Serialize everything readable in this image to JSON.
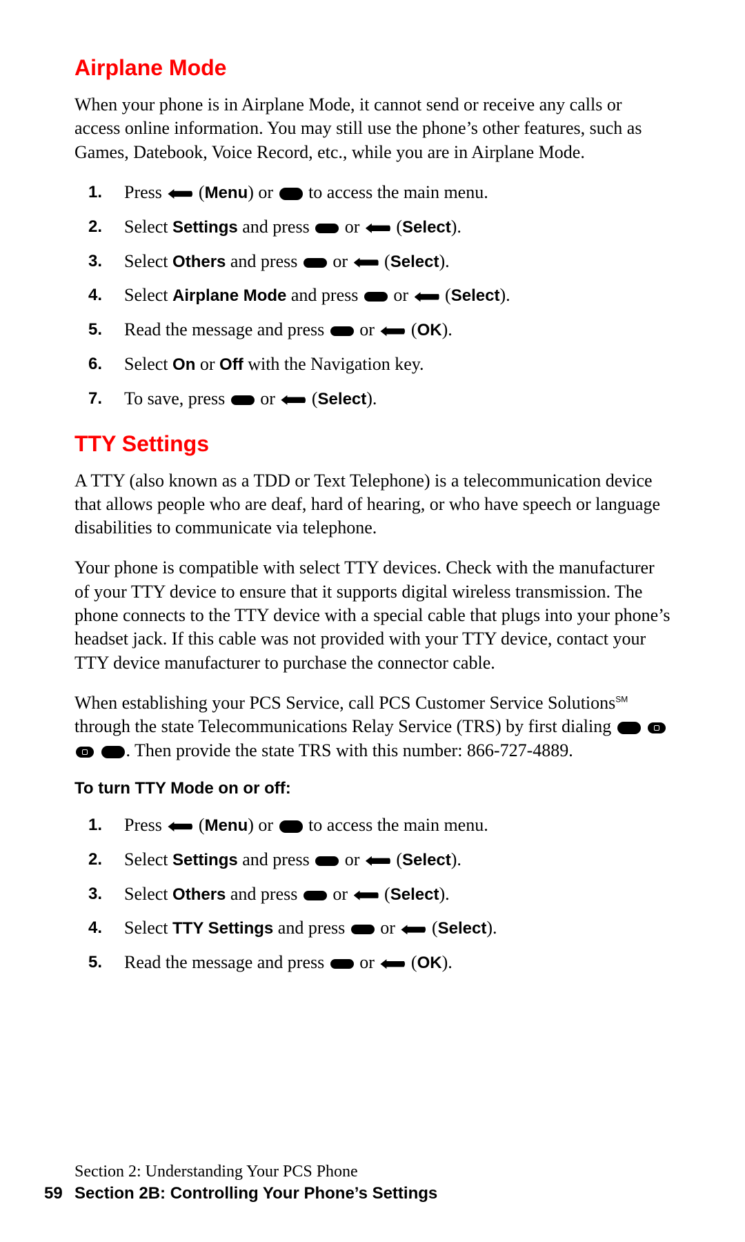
{
  "headings": {
    "airplane": "Airplane Mode",
    "tty": "TTY Settings"
  },
  "airplane": {
    "intro": "When your phone is in Airplane Mode, it cannot send or receive any calls or access online information. You may still use the phone’s other features, such as Games, Datebook, Voice Record, etc., while you are in Airplane Mode.",
    "steps": [
      {
        "n": "1.",
        "pre": "Press ",
        "b1": "Menu",
        "mid": ") or ",
        "post": " to access the main menu."
      },
      {
        "n": "2.",
        "pre": "Select ",
        "b1": "Settings",
        "mid": " and press ",
        "bl": "Select",
        "post": ")."
      },
      {
        "n": "3.",
        "pre": "Select ",
        "b1": "Others",
        "mid": " and press ",
        "bl": "Select",
        "post": ")."
      },
      {
        "n": "4.",
        "pre": "Select ",
        "b1": "Airplane Mode",
        "mid": " and press ",
        "bl": "Select",
        "post": ")."
      },
      {
        "n": "5.",
        "pre": "Read the message and press ",
        "bl": "OK",
        "post": ")."
      },
      {
        "n": "6.",
        "pre": "Select ",
        "b1": "On",
        "mid": " or ",
        "b2": "Off",
        "post": " with the Navigation key."
      },
      {
        "n": "7.",
        "pre": "To save, press ",
        "bl": "Select",
        "post": ")."
      }
    ]
  },
  "tty": {
    "p1": "A TTY (also known as a TDD or Text Telephone) is a telecommunication device that allows people who are deaf, hard of hearing, or who have speech or language disabilities to communicate via telephone.",
    "p2": "Your phone is compatible with select TTY devices. Check with the manufacturer of your TTY device to ensure that it supports digital wireless transmission. The phone connects to the TTY device with a special cable that plugs into your phone’s headset jack. If this cable was not provided with your TTY device, contact your TTY device manufacturer to purchase the connector cable.",
    "p3a": "When establishing your PCS Service, call PCS Customer Service Solutions",
    "p3sm": "SM",
    "p3b": " through the state Telecommunications Relay Service (TRS) by first dialing ",
    "p3c": ". Then provide the state TRS with this number: 866-727-4889.",
    "subhead": "To turn TTY Mode on or off:",
    "steps": [
      {
        "n": "1.",
        "pre": "Press ",
        "b1": "Menu",
        "mid": ") or ",
        "post": " to access the main menu."
      },
      {
        "n": "2.",
        "pre": "Select ",
        "b1": "Settings",
        "mid": " and press ",
        "bl": "Select",
        "post": ")."
      },
      {
        "n": "3.",
        "pre": "Select ",
        "b1": "Others",
        "mid": " and press ",
        "bl": "Select",
        "post": ")."
      },
      {
        "n": "4.",
        "pre": "Select ",
        "b1": "TTY Settings",
        "mid": " and press ",
        "bl": "Select",
        "post": ")."
      },
      {
        "n": "5.",
        "pre": "Read the message and press ",
        "bl": "OK",
        "post": ")."
      }
    ]
  },
  "footer": {
    "l1": "Section 2: Understanding Your PCS Phone",
    "l2": "Section 2B: Controlling Your Phone’s Settings",
    "page": "59"
  }
}
